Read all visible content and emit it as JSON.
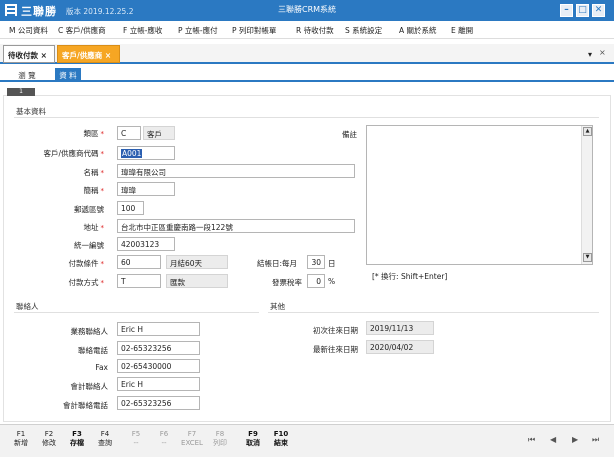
{
  "app": {
    "name": "三聯勝",
    "version": "版本 2019.12.25.2",
    "window_title": "三聯勝CRM系統",
    "window_buttons": [
      "–",
      "□",
      "✕"
    ]
  },
  "menu": [
    "M 公司資料",
    "C 客戶/供應商",
    "F 立帳-應收",
    "P 立帳-應付",
    "P 列印對帳單",
    "R 待收付款",
    "S 系統設定",
    "A 關於系統",
    "E 離開"
  ],
  "tabs": [
    {
      "label": "待收付款 ×"
    },
    {
      "label": "客戶/供應商 ×"
    }
  ],
  "tabstrip_controls": {
    "arrow": "▾",
    "close": "×"
  },
  "subtabs": [
    "瀏 覽",
    "資 料"
  ],
  "record_badge": "1",
  "basic": {
    "section": "基本資料",
    "type_label": "類區",
    "type_code": "C",
    "type_name": "客戶",
    "code_label": "客戶/供應商代碼",
    "code_value": "A001",
    "name_label": "名稱",
    "name_value": "瑋瑋有限公司",
    "short_label": "簡稱",
    "short_value": "瑋瑋",
    "zip_label": "郵遞區號",
    "zip_value": "100",
    "addr_label": "地址",
    "addr_value": "台北市中正區重慶南路一段122號",
    "tax_label": "統一編號",
    "tax_value": "42003123",
    "pay_term_label": "付款條件",
    "pay_term_value": "60",
    "pay_term_desc": "月結60天",
    "pay_method_label": "付款方式",
    "pay_method_value": "T",
    "pay_method_desc": "匯款",
    "close_day_label": "結帳日:每月",
    "close_day_value": "30",
    "close_day_unit": "日",
    "rate_label": "發票稅率",
    "rate_value": "0",
    "rate_unit": "%",
    "note_label": "備註",
    "note_hint": "[* 換行: Shift+Enter]",
    "req_mark": "*"
  },
  "contacts": {
    "section": "聯絡人",
    "biz_contact_label": "業務聯絡人",
    "biz_contact_value": "Eric H",
    "phone_label": "聯絡電話",
    "phone_value": "02-65323256",
    "fax_label": "Fax",
    "fax_value": "02-65430000",
    "acc_contact_label": "會計聯絡人",
    "acc_contact_value": "Eric H",
    "acc_phone_label": "會計聯絡電話",
    "acc_phone_value": "02-65323256"
  },
  "other": {
    "section": "其他",
    "first_date_label": "初次往來日期",
    "first_date_value": "2019/11/13",
    "last_date_label": "最新往來日期",
    "last_date_value": "2020/04/02"
  },
  "fkeys": [
    {
      "key": "F1",
      "label": "新增",
      "enabled": true
    },
    {
      "key": "F2",
      "label": "修改",
      "enabled": true
    },
    {
      "key": "F3",
      "label": "存檔",
      "enabled": true
    },
    {
      "key": "F4",
      "label": "查詢",
      "enabled": true
    },
    {
      "key": "F5",
      "label": "--",
      "enabled": false
    },
    {
      "key": "F6",
      "label": "--",
      "enabled": false
    },
    {
      "key": "F7",
      "label": "EXCEL",
      "enabled": false
    },
    {
      "key": "F8",
      "label": "列印",
      "enabled": false
    },
    {
      "key": "F9",
      "label": "取消",
      "enabled": true
    },
    {
      "key": "F10",
      "label": "結束",
      "enabled": true
    }
  ],
  "record_nav": [
    "⏮",
    "◀",
    "▶",
    "⏭"
  ],
  "colors": {
    "accent": "#2b79c2",
    "active_tab": "#f6a623",
    "required": "#d22222"
  }
}
